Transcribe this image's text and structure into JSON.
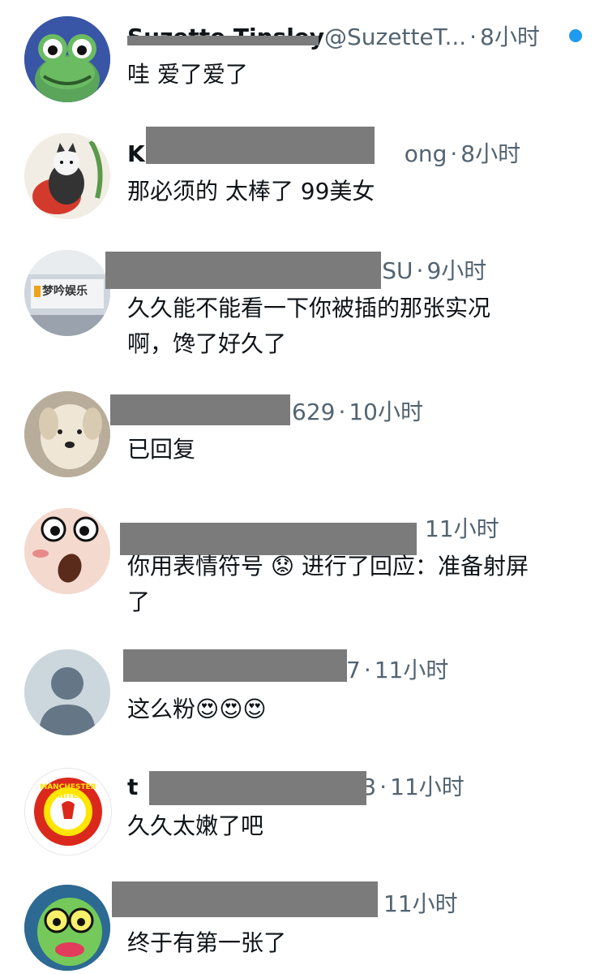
{
  "notifications": [
    {
      "name": "Suzette Tinsley",
      "handle": "@SuzetteT...",
      "time": "8小时",
      "text": "哇 爱了爱了",
      "avatar": "frog-avatar",
      "unread": true
    },
    {
      "name": "K",
      "handle": "ong",
      "time": "8小时",
      "text": "那必须的 太棒了 99美女",
      "avatar": "cat-avatar"
    },
    {
      "name": "",
      "handle": "JSU",
      "time": "9小时",
      "text": "久久能不能看一下你被插的那张实况啊，馋了好久了",
      "avatar": "company-logo-avatar",
      "avatar_caption": "梦吟娱乐"
    },
    {
      "name": "",
      "handle": "629",
      "time": "10小时",
      "text": "已回复",
      "avatar": "dog-avatar"
    },
    {
      "name": "",
      "handle": "",
      "time": "11小时",
      "text": "你用表情符号 😟 进行了回应：准备射屏了",
      "avatar": "cartoon-face-avatar"
    },
    {
      "name": "",
      "handle": "7",
      "time": "11小时",
      "text": "这么粉😍😍😍",
      "avatar": "default-user-avatar"
    },
    {
      "name": "t",
      "handle": "3",
      "time": "11小时",
      "text": "久久太嫩了吧",
      "avatar": "football-club-crest-avatar",
      "avatar_caption": "MANCHESTER UNITED"
    },
    {
      "name": "",
      "handle": "",
      "time": "11小时",
      "text": "终于有第一张了",
      "avatar": "zombie-cartoon-avatar"
    }
  ],
  "separator": "·",
  "colors": {
    "accent": "#1d9bf0",
    "secondary_text": "#536471",
    "redaction": "#7b7b7b"
  }
}
